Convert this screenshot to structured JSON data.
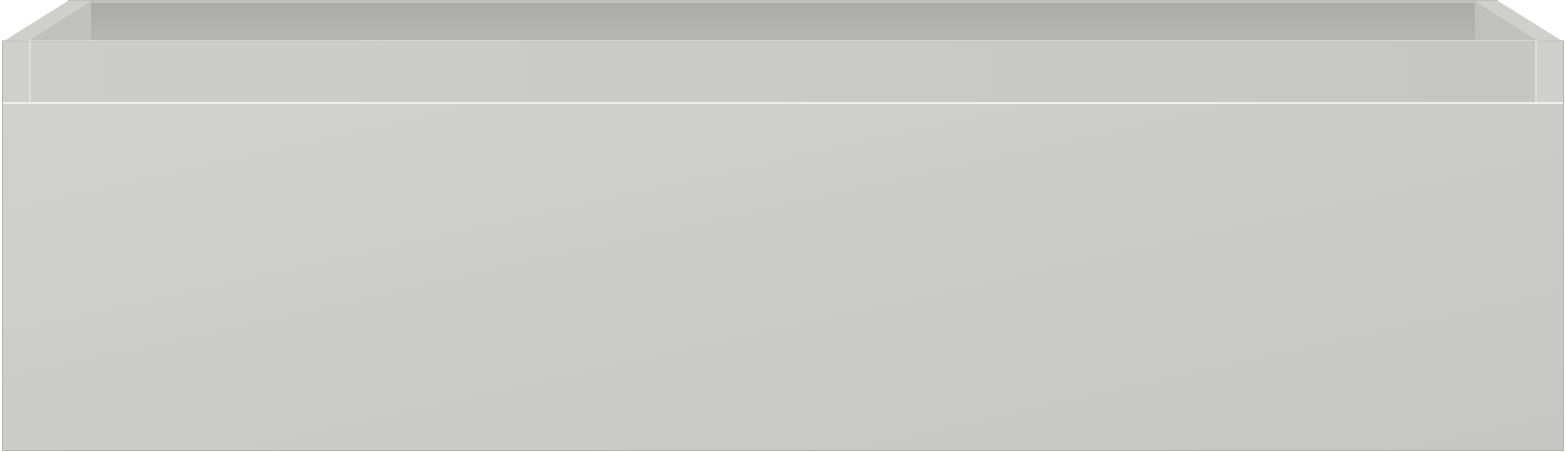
{
  "object": {
    "kind": "open drawer box, product render",
    "colors": {
      "front_face": "#cbcbc9",
      "front_face_light": "#d1d1cf",
      "front_face_dark": "#c6c6c4",
      "inner_back_wall": "#b6b6b5",
      "inner_back_wall_top": "#aaaaa9",
      "top_rim": "#bfbfbe",
      "inner_side_wall": "#c0c0bf",
      "side_post": "#cfcfcd",
      "side_post_edge": "#c4c4c2",
      "upper_band": "#cdcdcb",
      "edge_highlight": "#eeeeec",
      "edge_shadow": "#a9a9a8",
      "outline": "#b3b3b1"
    }
  }
}
